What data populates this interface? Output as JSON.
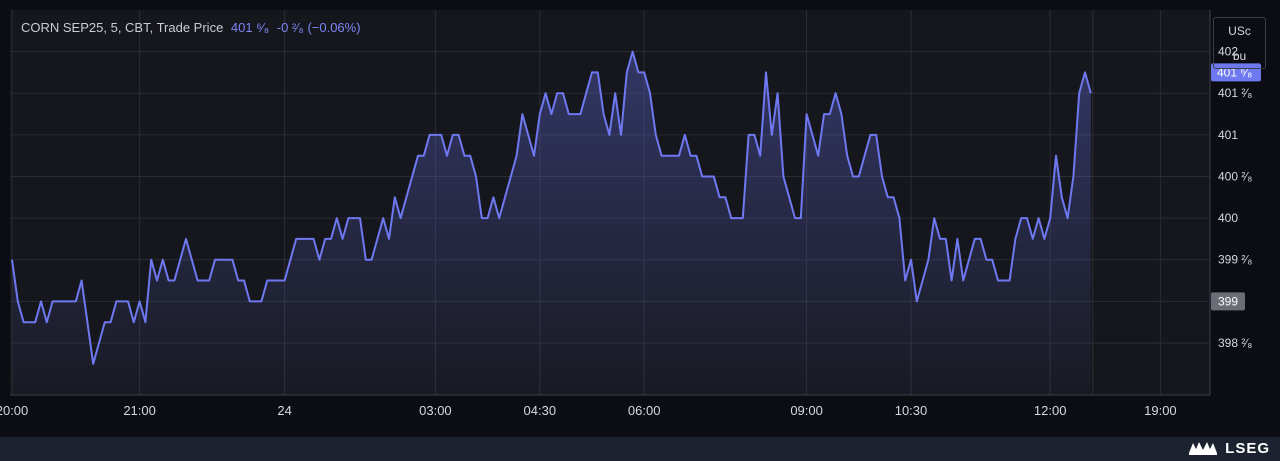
{
  "legend": {
    "symbol": "CORN SEP25, 5, CBT, Trade Price",
    "last": "401 ⁶⁄₈",
    "change": "-0 ²⁄₈ (−0.06%)"
  },
  "units": {
    "line1": "USc",
    "line2": "bu"
  },
  "brand": {
    "name": "LSEG"
  },
  "colors": {
    "line": "#6e78f0",
    "background": "#16171c",
    "grid": "#2a2d35",
    "last_label": "#6e78f0",
    "ref_label": "#6a6d75"
  },
  "chart_data": {
    "type": "area",
    "title": "CORN SEP25, 5, CBT, Trade Price",
    "xlabel": "",
    "ylabel": "USc/bu",
    "ylim": [
      397.625,
      402.25
    ],
    "y_ticks": [
      {
        "value": 398.25,
        "label": "398 ²⁄₈"
      },
      {
        "value": 398.75,
        "label": "399"
      },
      {
        "value": 399.25,
        "label": "399 ²⁄₈"
      },
      {
        "value": 399.75,
        "label": "400"
      },
      {
        "value": 400.25,
        "label": "400 ²⁄₈"
      },
      {
        "value": 400.75,
        "label": "401"
      },
      {
        "value": 401.25,
        "label": "401 ²⁄₈"
      },
      {
        "value": 401.75,
        "label": "402"
      }
    ],
    "x_ticks": [
      {
        "index": 0,
        "label": "20:00"
      },
      {
        "index": 22,
        "label": "21:00"
      },
      {
        "index": 47,
        "label": "24"
      },
      {
        "index": 73,
        "label": "03:00"
      },
      {
        "index": 91,
        "label": "04:30"
      },
      {
        "index": 109,
        "label": "06:00"
      },
      {
        "index": 137,
        "label": "09:00"
      },
      {
        "index": 155,
        "label": "10:30"
      },
      {
        "index": 179,
        "label": "12:00"
      },
      {
        "index": 198,
        "label": "19:00"
      }
    ],
    "last_value": 401.5,
    "last_value_label": "401 ⁶⁄₈",
    "reference_value": 398.75,
    "reference_label": "399",
    "values": [
      399.25,
      398.75,
      398.5,
      398.5,
      398.5,
      398.75,
      398.5,
      398.75,
      398.75,
      398.75,
      398.75,
      398.75,
      399.0,
      398.5,
      398.0,
      398.25,
      398.5,
      398.5,
      398.75,
      398.75,
      398.75,
      398.5,
      398.75,
      398.5,
      399.25,
      399.0,
      399.25,
      399.0,
      399.0,
      399.25,
      399.5,
      399.25,
      399.0,
      399.0,
      399.0,
      399.25,
      399.25,
      399.25,
      399.25,
      399.0,
      399.0,
      398.75,
      398.75,
      398.75,
      399.0,
      399.0,
      399.0,
      399.0,
      399.25,
      399.5,
      399.5,
      399.5,
      399.5,
      399.25,
      399.5,
      399.5,
      399.75,
      399.5,
      399.75,
      399.75,
      399.75,
      399.25,
      399.25,
      399.5,
      399.75,
      399.5,
      400.0,
      399.75,
      400.0,
      400.25,
      400.5,
      400.5,
      400.75,
      400.75,
      400.75,
      400.5,
      400.75,
      400.75,
      400.5,
      400.5,
      400.25,
      399.75,
      399.75,
      400.0,
      399.75,
      400.0,
      400.25,
      400.5,
      401.0,
      400.75,
      400.5,
      401.0,
      401.25,
      401.0,
      401.25,
      401.25,
      401.0,
      401.0,
      401.0,
      401.25,
      401.5,
      401.5,
      401.0,
      400.75,
      401.25,
      400.75,
      401.5,
      401.75,
      401.5,
      401.5,
      401.25,
      400.75,
      400.5,
      400.5,
      400.5,
      400.5,
      400.75,
      400.5,
      400.5,
      400.25,
      400.25,
      400.25,
      400.0,
      400.0,
      399.75,
      399.75,
      399.75,
      400.75,
      400.75,
      400.5,
      401.5,
      400.75,
      401.25,
      400.25,
      400.0,
      399.75,
      399.75,
      401.0,
      400.75,
      400.5,
      401.0,
      401.0,
      401.25,
      401.0,
      400.5,
      400.25,
      400.25,
      400.5,
      400.75,
      400.75,
      400.25,
      400.0,
      400.0,
      399.75,
      399.0,
      399.25,
      398.75,
      399.0,
      399.25,
      399.75,
      399.5,
      399.5,
      399.0,
      399.5,
      399.0,
      399.25,
      399.5,
      399.5,
      399.25,
      399.25,
      399.0,
      399.0,
      399.0,
      399.5,
      399.75,
      399.75,
      399.5,
      399.75,
      399.5,
      399.75,
      400.5,
      400.0,
      399.75,
      400.25,
      401.25,
      401.5,
      401.25
    ]
  }
}
